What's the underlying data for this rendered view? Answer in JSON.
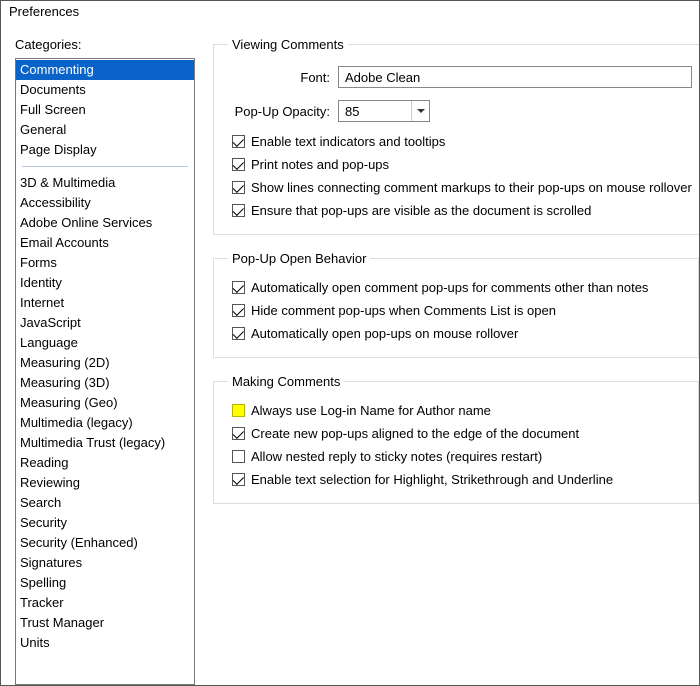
{
  "window": {
    "title": "Preferences"
  },
  "sidebar": {
    "label": "Categories:",
    "group1": [
      "Commenting",
      "Documents",
      "Full Screen",
      "General",
      "Page Display"
    ],
    "group2": [
      "3D & Multimedia",
      "Accessibility",
      "Adobe Online Services",
      "Email Accounts",
      "Forms",
      "Identity",
      "Internet",
      "JavaScript",
      "Language",
      "Measuring (2D)",
      "Measuring (3D)",
      "Measuring (Geo)",
      "Multimedia (legacy)",
      "Multimedia Trust (legacy)",
      "Reading",
      "Reviewing",
      "Search",
      "Security",
      "Security (Enhanced)",
      "Signatures",
      "Spelling",
      "Tracker",
      "Trust Manager",
      "Units"
    ],
    "selected": "Commenting"
  },
  "viewing": {
    "legend": "Viewing Comments",
    "font_label": "Font:",
    "font_value": "Adobe Clean",
    "opacity_label": "Pop-Up Opacity:",
    "opacity_value": "85",
    "checks": [
      {
        "label": "Enable text indicators and tooltips",
        "checked": true
      },
      {
        "label": "Print notes and pop-ups",
        "checked": true
      },
      {
        "label": "Show lines connecting comment markups to their pop-ups on mouse rollover",
        "checked": true
      },
      {
        "label": "Ensure that pop-ups are visible as the document is scrolled",
        "checked": true
      }
    ]
  },
  "popup": {
    "legend": "Pop-Up Open Behavior",
    "checks": [
      {
        "label": "Automatically open comment pop-ups for comments other than notes",
        "checked": true
      },
      {
        "label": "Hide comment pop-ups when Comments List is open",
        "checked": true
      },
      {
        "label": "Automatically open pop-ups on mouse rollover",
        "checked": true
      }
    ]
  },
  "making": {
    "legend": "Making Comments",
    "checks": [
      {
        "label": "Always use Log-in Name for Author name",
        "checked": false,
        "highlight": true
      },
      {
        "label": "Create new pop-ups aligned to the edge of the document",
        "checked": true
      },
      {
        "label": "Allow nested reply to sticky notes (requires restart)",
        "checked": false
      },
      {
        "label": "Enable text selection for Highlight, Strikethrough and Underline",
        "checked": true
      }
    ]
  }
}
